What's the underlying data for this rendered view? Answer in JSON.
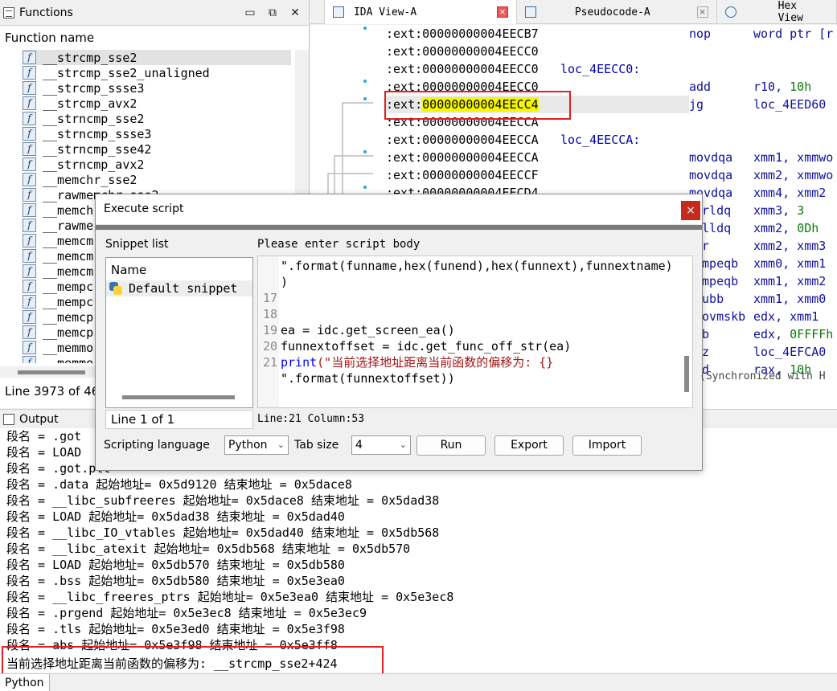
{
  "functions": {
    "title": "Functions",
    "column_header": "Function name",
    "items": [
      "__strcmp_sse2",
      "__strcmp_sse2_unaligned",
      "__strcmp_ssse3",
      "__strcmp_avx2",
      "__strncmp_sse2",
      "__strncmp_ssse3",
      "__strncmp_sse42",
      "__strncmp_avx2",
      "__memchr_sse2",
      "__rawmemchr_sse2",
      "__memch",
      "__rawme",
      "__memcm",
      "__memcm",
      "__memcm",
      "__mempc",
      "__mempc",
      "__memcp",
      "__memcp",
      "__memmo",
      "__memmo"
    ],
    "status": "Line 3973 of 46"
  },
  "tabs": [
    {
      "label": "IDA View-A"
    },
    {
      "label": "Pseudocode-A"
    },
    {
      "label": "Hex View"
    }
  ],
  "disasm": {
    "lines": [
      {
        "addr": ":ext:00000000004EECB7",
        "label": "",
        "mnem": "nop",
        "ops": "word ptr [r"
      },
      {
        "addr": ":ext:00000000004EECC0",
        "label": "",
        "mnem": "",
        "ops": ""
      },
      {
        "addr": ":ext:00000000004EECC0",
        "label": "loc_4EECC0:",
        "mnem": "",
        "ops": ""
      },
      {
        "addr": ":ext:00000000004EECC0",
        "label": "",
        "mnem": "add",
        "ops": "r10, ",
        "num": "10h"
      },
      {
        "addr_prefix": ":ext:",
        "addr_hl": "00000000004EECC4",
        "label": "",
        "mnem": "jg",
        "ops": "loc_4EED60"
      },
      {
        "addr": ":ext:00000000004EECCA",
        "label": "",
        "mnem": "",
        "ops": ""
      },
      {
        "addr": ":ext:00000000004EECCA",
        "label": "loc_4EECCA:",
        "mnem": "",
        "ops": ""
      },
      {
        "addr": ":ext:00000000004EECCA",
        "label": "",
        "mnem": "movdqa",
        "ops": "xmm1, xmmwo"
      },
      {
        "addr": ":ext:00000000004EECCF",
        "label": "",
        "mnem": "movdqa",
        "ops": "xmm2, xmmwo"
      },
      {
        "addr": ":ext:00000000004EECD4",
        "label": "",
        "mnem": "movdqa",
        "ops": "xmm4, xmm2"
      }
    ],
    "right_fragments": [
      {
        "mnem": "srldq",
        "ops": "xmm3, ",
        "num": "3"
      },
      {
        "mnem": "slldq",
        "ops": "xmm2, ",
        "num": "0Dh"
      },
      {
        "mnem": "or",
        "ops": "xmm2, xmm3"
      },
      {
        "mnem": "cmpeqb",
        "ops": "xmm0, xmm1"
      },
      {
        "mnem": "cmpeqb",
        "ops": "xmm1, xmm2"
      },
      {
        "mnem": "subb",
        "ops": "xmm1, xmm0"
      },
      {
        "mnem": "novmskb",
        "ops": "edx, xmm1"
      },
      {
        "mnem": "ub",
        "ops": "edx, ",
        "num": "0FFFFh"
      },
      {
        "mnem": "nz",
        "ops": "loc_4EFCA0"
      },
      {
        "mnem": "dd",
        "ops": "rax, ",
        "num": "10h"
      }
    ],
    "sync_text": "(Synchronized with H"
  },
  "output": {
    "title": "Output",
    "lines": [
      "段名 = .got ",
      "段名 = LOAD ",
      "段名 = .got.plt",
      "段名 = .data 起始地址= 0x5d9120 结束地址 = 0x5dace8",
      "段名 = __libc_subfreeres 起始地址= 0x5dace8 结束地址 = 0x5dad38",
      "段名 = LOAD 起始地址= 0x5dad38 结束地址 = 0x5dad40",
      "段名 = __libc_IO_vtables 起始地址= 0x5dad40 结束地址 = 0x5db568",
      "段名 = __libc_atexit 起始地址= 0x5db568 结束地址 = 0x5db570",
      "段名 = LOAD 起始地址= 0x5db570 结束地址 = 0x5db580",
      "段名 = .bss 起始地址= 0x5db580 结束地址 = 0x5e3ea0",
      "段名 = __libc_freeres_ptrs 起始地址= 0x5e3ea0 结束地址 = 0x5e3ec8",
      "段名 = .prgend 起始地址= 0x5e3ec8 结束地址 = 0x5e3ec9",
      "段名 = .tls 起始地址= 0x5e3ed0 结束地址 = 0x5e3f98",
      "段名 = abs 起始地址= 0x5e3f98 结束地址 = 0x5e3ff8"
    ],
    "final_line": "当前选择地址距离当前函数的偏移为: __strcmp_sse2+424",
    "python_tab": "Python"
  },
  "dialog": {
    "title": "Execute script",
    "close": "×",
    "snippet_list_label": "Snippet list",
    "snippet_header": "Name",
    "snippets": [
      "Default snippet"
    ],
    "snippet_status": "Line 1 of 1",
    "body_label": "Please enter script body",
    "code_lines": [
      {
        "ln": "",
        "text": "\".format(funname,hex(funend),hex(funnext),funnextname)"
      },
      {
        "ln": "",
        "text": ")"
      },
      {
        "ln": "17",
        "text": ""
      },
      {
        "ln": "18",
        "text": ""
      },
      {
        "ln": "19",
        "text": "ea = idc.get_screen_ea()"
      },
      {
        "ln": "20",
        "text": "funnextoffset = idc.get_func_off_str(ea)"
      },
      {
        "ln": "21",
        "kw": "print",
        "str": "(\"当前选择地址距离当前函数的偏移为: {}"
      },
      {
        "ln": "",
        "text": "\".format(funnextoffset))"
      }
    ],
    "cursor_pos": "Line:21 Column:53",
    "language_label": "Scripting language",
    "language_value": "Python",
    "tab_size_label": "Tab size",
    "tab_size_value": "4",
    "run_label": "Run",
    "export_label": "Export",
    "import_label": "Import"
  }
}
